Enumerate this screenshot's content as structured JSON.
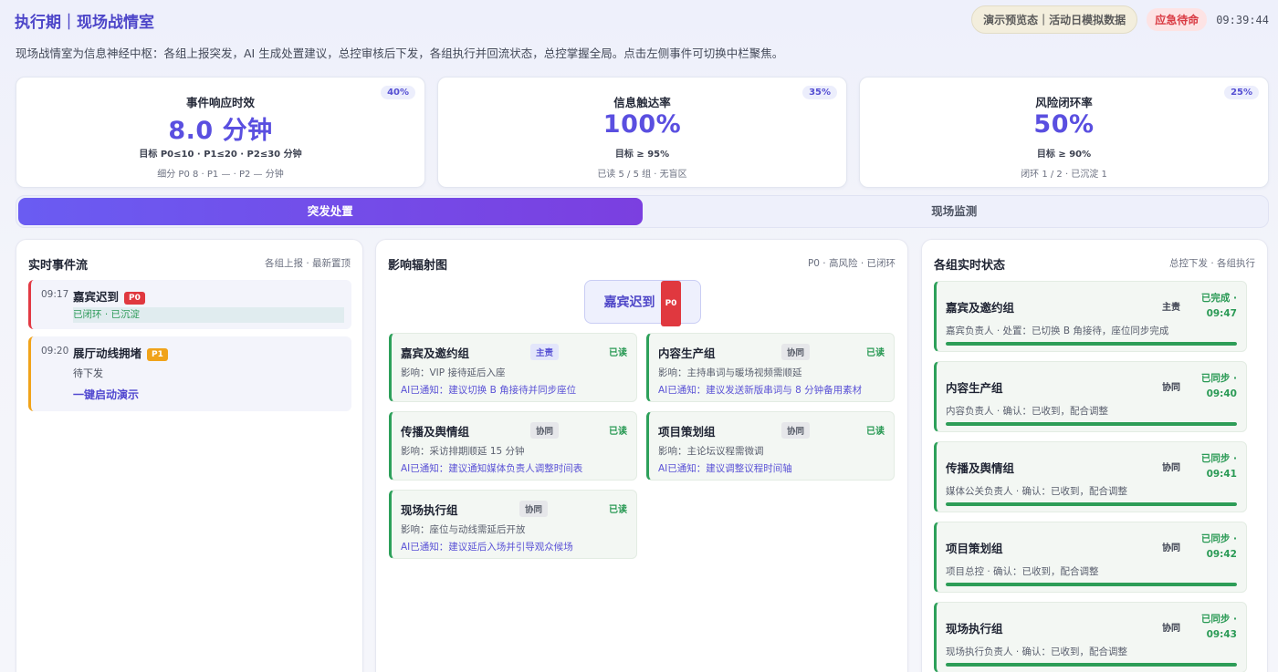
{
  "header": {
    "title": "执行期｜现场战情室",
    "demo_label": "演示预览态｜活动日模拟数据",
    "urgent_label": "应急待命",
    "clock": "09:39:44",
    "subtitle": "现场战情室为信息神经中枢：各组上报突发，AI 生成处置建议，总控审核后下发，各组执行并回流状态，总控掌握全局。点击左侧事件可切换中栏聚焦。"
  },
  "kpis": [
    {
      "label": "事件响应时效",
      "value": "8.0 分钟",
      "weight": "40%",
      "target": "目标 P0≤10 · P1≤20 · P2≤30 分钟",
      "detail": "细分 P0 8 · P1 — · P2 — 分钟"
    },
    {
      "label": "信息触达率",
      "value": "100%",
      "weight": "35%",
      "target": "目标 ≥ 95%",
      "detail": "已读 5 / 5 组 · 无盲区"
    },
    {
      "label": "风险闭环率",
      "value": "50%",
      "weight": "25%",
      "target": "目标 ≥ 90%",
      "detail": "闭环 1 / 2 · 已沉淀 1"
    }
  ],
  "tabs": [
    {
      "label": "突发处置",
      "active": true
    },
    {
      "label": "现场监测",
      "active": false
    }
  ],
  "events_panel": {
    "title": "实时事件流",
    "meta": "各组上报 · 最新置顶",
    "events": [
      {
        "time": "09:17",
        "name": "嘉宾迟到",
        "priority": "P0",
        "status": "已闭环 · 已沉淀"
      },
      {
        "time": "09:20",
        "name": "展厅动线拥堵",
        "priority": "P1",
        "status": "待下发",
        "action": "一键启动演示"
      }
    ]
  },
  "impact_panel": {
    "title": "影响辐射图",
    "meta": "P0 · 高风险 · 已闭环",
    "center": {
      "name": "嘉宾迟到",
      "priority": "P0"
    },
    "nodes": [
      {
        "name": "嘉宾及邀约组",
        "role": "主责",
        "read": "已读",
        "impact": "影响：VIP 接待延后入座",
        "ai": "AI已通知：建议切换 B 角接待并同步座位"
      },
      {
        "name": "内容生产组",
        "role": "协同",
        "read": "已读",
        "impact": "影响：主持串词与暖场视频需顺延",
        "ai": "AI已通知：建议发送新版串词与 8 分钟备用素材"
      },
      {
        "name": "传播及舆情组",
        "role": "协同",
        "read": "已读",
        "impact": "影响：采访排期顺延 15 分钟",
        "ai": "AI已通知：建议通知媒体负责人调整时间表"
      },
      {
        "name": "项目策划组",
        "role": "协同",
        "read": "已读",
        "impact": "影响：主论坛议程需微调",
        "ai": "AI已通知：建议调整议程时间轴"
      },
      {
        "name": "现场执行组",
        "role": "协同",
        "read": "已读",
        "impact": "影响：座位与动线需延后开放",
        "ai": "AI已通知：建议延后入场并引导观众候场"
      }
    ]
  },
  "groups_panel": {
    "title": "各组实时状态",
    "meta": "总控下发 · 各组执行",
    "groups": [
      {
        "name": "嘉宾及邀约组",
        "role": "主责",
        "state": "已完成 ·",
        "time": "09:47",
        "desc": "嘉宾负责人 · 处置：已切换 B 角接待，座位同步完成",
        "progress": 1.0
      },
      {
        "name": "内容生产组",
        "role": "协同",
        "state": "已同步 ·",
        "time": "09:40",
        "desc": "内容负责人 · 确认：已收到，配合调整",
        "progress": 1.0
      },
      {
        "name": "传播及舆情组",
        "role": "协同",
        "state": "已同步 ·",
        "time": "09:41",
        "desc": "媒体公关负责人 · 确认：已收到，配合调整",
        "progress": 1.0
      },
      {
        "name": "项目策划组",
        "role": "协同",
        "state": "已同步 ·",
        "time": "09:42",
        "desc": "项目总控 · 确认：已收到，配合调整",
        "progress": 1.0
      },
      {
        "name": "现场执行组",
        "role": "协同",
        "state": "已同步 ·",
        "time": "09:43",
        "desc": "现场执行负责人 · 确认：已收到，配合调整",
        "progress": 1.0
      }
    ]
  },
  "colors": {
    "accent": "#5a4fe0",
    "danger": "#e0383f",
    "warning": "#f0a31a",
    "success": "#2d9d57"
  }
}
